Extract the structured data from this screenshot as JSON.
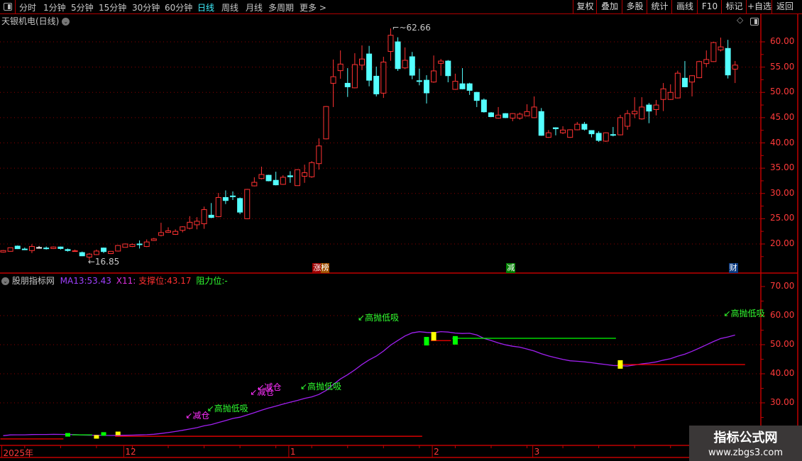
{
  "toolbar": {
    "periods": [
      "分时",
      "1分钟",
      "5分钟",
      "15分钟",
      "30分钟",
      "60分钟",
      "日线",
      "周线",
      "月线",
      "多周期",
      "更多 >"
    ],
    "active_period": "日线",
    "buttons": [
      "复权",
      "叠加",
      "多股",
      "统计",
      "画线",
      "F10",
      "标记",
      "+自选",
      "返回"
    ]
  },
  "price_panel": {
    "title": "天银机电(日线)",
    "axis_ticks": [
      "60.00",
      "55.00",
      "50.00",
      "45.00",
      "40.00",
      "35.00",
      "30.00",
      "25.00",
      "20.00"
    ],
    "high_label": "62.66",
    "low_label": "16.85",
    "tags": [
      {
        "text": "涨榜",
        "bar": 44,
        "colors": [
          "#a00000",
          "#a05000"
        ]
      },
      {
        "text": "减",
        "bar": 71,
        "colors": [
          "#008000"
        ]
      },
      {
        "text": "财",
        "bar": 102,
        "colors": [
          "#0a3a80"
        ]
      }
    ]
  },
  "indicator_panel": {
    "name": "股朋指标网",
    "ma13_label": "MA13:",
    "ma13_value": "53.43",
    "x11_label": "X11:",
    "support_label": "支撑位:",
    "support_value": "43.17",
    "resistance_label": "阻力位:",
    "resistance_value": "-",
    "axis_ticks": [
      "70.00",
      "60.00",
      "50.00",
      "40.00",
      "30.00"
    ],
    "signal_labels": [
      {
        "text": "减仓",
        "bar": 26,
        "value": 25.9,
        "color": "#ff30ff"
      },
      {
        "text": "高抛低吸",
        "bar": 29,
        "value": 28.3,
        "color": "#30ff30"
      },
      {
        "text": "减仓",
        "bar": 35,
        "value": 33.9,
        "color": "#ff30ff"
      },
      {
        "text": "减仓",
        "bar": 36,
        "value": 35.6,
        "color": "#ff30ff"
      },
      {
        "text": "高抛低吸",
        "bar": 42,
        "value": 35.9,
        "color": "#30ff30"
      },
      {
        "text": "高抛低吸",
        "bar": 50,
        "value": 59.5,
        "color": "#30ff30"
      },
      {
        "text": "高抛低吸",
        "bar": 101,
        "value": 61,
        "color": "#30ff30"
      }
    ],
    "signal_blocks": [
      {
        "bar": 9,
        "value": 19.0,
        "color": "#00ff00"
      },
      {
        "bar": 13,
        "value": 18.3,
        "color": "#ffff00"
      },
      {
        "bar": 14,
        "value": 19.3,
        "color": "#00ff00"
      },
      {
        "bar": 16,
        "value": 19.5,
        "color": "#ffff00"
      },
      {
        "bar": 59,
        "value": 51.2,
        "color": "#00ff00"
      },
      {
        "bar": 60,
        "value": 52.9,
        "color": "#ffff00"
      },
      {
        "bar": 63,
        "value": 51.5,
        "color": "#00ff00"
      },
      {
        "bar": 86,
        "value": 43.2,
        "color": "#ffff00"
      }
    ],
    "levels": [
      {
        "from": 0,
        "to": 8,
        "value": 17.6,
        "color": "#ff0000"
      },
      {
        "from": 10,
        "to": 12,
        "value": 19.0,
        "color": "#00ff00"
      },
      {
        "from": 16,
        "to": 58,
        "value": 18.5,
        "color": "#ff0000"
      },
      {
        "from": 60,
        "to": 62,
        "value": 51.4,
        "color": "#ff0000"
      },
      {
        "from": 63,
        "to": 85,
        "value": 52.2,
        "color": "#00ff00"
      },
      {
        "from": 86,
        "to": 103,
        "value": 43.17,
        "color": "#ff0000"
      }
    ]
  },
  "date_axis": [
    {
      "text": "2025年",
      "bar": 0
    },
    {
      "text": "12",
      "bar": 17
    },
    {
      "text": "1",
      "bar": 40
    },
    {
      "text": "2",
      "bar": 60
    },
    {
      "text": "3",
      "bar": 74
    }
  ],
  "watermark": {
    "line1": "指标公式网",
    "line2": "www.zbgs3.com"
  },
  "colors": {
    "up": "#ff3232",
    "down": "#54ffff",
    "ma": "#a020f0",
    "axis": "#c00000",
    "grid": "#8b0000"
  },
  "candles": [
    [
      18.4,
      18.8,
      18.3,
      18.7
    ],
    [
      18.55,
      19.3,
      18.5,
      19.26
    ],
    [
      19.58,
      19.7,
      19.0,
      19.06
    ],
    [
      19.0,
      19.3,
      18.8,
      18.95
    ],
    [
      18.7,
      19.96,
      18.2,
      19.5
    ],
    [
      19.3,
      19.6,
      19.2,
      19.3
    ],
    [
      19.2,
      19.5,
      18.9,
      19.1
    ],
    [
      19.1,
      19.5,
      19.0,
      19.4
    ],
    [
      19.4,
      19.5,
      18.9,
      19.1
    ],
    [
      18.9,
      19.1,
      18.5,
      18.7
    ],
    [
      18.55,
      18.9,
      18.5,
      18.65
    ],
    [
      18.3,
      18.5,
      17.6,
      17.65
    ],
    [
      17.4,
      18.2,
      16.85,
      18.0
    ],
    [
      17.9,
      18.9,
      17.8,
      18.6
    ],
    [
      19.2,
      19.3,
      18.2,
      18.5
    ],
    [
      18.1,
      18.6,
      18.0,
      18.55
    ],
    [
      18.6,
      19.8,
      18.5,
      19.7
    ],
    [
      19.34,
      20.1,
      19.3,
      20.0
    ],
    [
      19.5,
      20.1,
      19.4,
      19.9
    ],
    [
      20.0,
      20.7,
      19.1,
      19.95
    ],
    [
      19.5,
      20.9,
      19.4,
      20.4
    ],
    [
      20.7,
      21.2,
      20.6,
      21.0
    ],
    [
      21.7,
      24.2,
      21.5,
      22.25
    ],
    [
      22.3,
      23.3,
      22.2,
      22.6
    ],
    [
      21.9,
      22.9,
      21.8,
      22.5
    ],
    [
      22.7,
      23.5,
      22.3,
      23.4
    ],
    [
      23.1,
      25.5,
      22.9,
      24.3
    ],
    [
      23.8,
      25.3,
      22.9,
      24.5
    ],
    [
      24.0,
      27.4,
      23.0,
      26.8
    ],
    [
      25.7,
      28.1,
      25.1,
      25.25
    ],
    [
      25.4,
      30.1,
      25.3,
      29.2
    ],
    [
      29.2,
      30.6,
      27.9,
      28.6
    ],
    [
      29.5,
      30.4,
      28.7,
      29.4
    ],
    [
      29.0,
      29.2,
      25.9,
      26.3
    ],
    [
      25.0,
      30.9,
      24.9,
      30.8
    ],
    [
      31.5,
      33.2,
      31.4,
      32.2
    ],
    [
      32.95,
      35.3,
      32.8,
      33.75
    ],
    [
      33.6,
      33.7,
      32.4,
      32.5
    ],
    [
      32.6,
      34.3,
      31.6,
      31.7
    ],
    [
      31.8,
      33.6,
      31.7,
      33.2
    ],
    [
      33.5,
      34.4,
      32.1,
      33.3
    ],
    [
      31.55,
      34.8,
      31.5,
      34.7
    ],
    [
      33.4,
      35.7,
      32.1,
      34.1
    ],
    [
      33.3,
      36.4,
      33.1,
      36.1
    ],
    [
      35.9,
      40.9,
      34.7,
      39.4
    ],
    [
      40.8,
      47.3,
      40.7,
      47.2
    ],
    [
      51.8,
      56.5,
      47.1,
      53.1
    ],
    [
      54.3,
      58.3,
      52.7,
      55.6
    ],
    [
      51.8,
      54.8,
      49.1,
      51.1
    ],
    [
      50.9,
      57.75,
      50.8,
      55.5
    ],
    [
      55.4,
      59.3,
      54.4,
      56.6
    ],
    [
      57.6,
      59.2,
      51.2,
      52.4
    ],
    [
      53.2,
      55.1,
      49.2,
      49.7
    ],
    [
      49.85,
      57.05,
      48.9,
      56.0
    ],
    [
      58.1,
      62.66,
      56.25,
      61.3
    ],
    [
      60.0,
      60.9,
      54.25,
      54.7
    ],
    [
      54.85,
      58.9,
      54.6,
      56.35
    ],
    [
      57.05,
      58.0,
      52.6,
      53.4
    ],
    [
      52.3,
      54.7,
      51.4,
      52.2
    ],
    [
      52.4,
      53.4,
      47.8,
      49.9
    ],
    [
      52.05,
      57.3,
      51.9,
      54.25
    ],
    [
      55.75,
      56.6,
      53.3,
      56.2
    ],
    [
      56.2,
      56.4,
      52.0,
      53.3
    ],
    [
      50.6,
      53.7,
      50.5,
      52.2
    ],
    [
      51.7,
      54.8,
      50.6,
      50.7
    ],
    [
      51.7,
      51.9,
      49.5,
      50.4
    ],
    [
      50.0,
      50.1,
      47.1,
      48.4
    ],
    [
      48.5,
      48.8,
      46.0,
      46.15
    ],
    [
      45.95,
      46.1,
      45.1,
      45.2
    ],
    [
      44.9,
      47.1,
      44.8,
      45.5
    ],
    [
      45.8,
      45.9,
      44.9,
      45.0
    ],
    [
      44.9,
      45.9,
      44.3,
      45.8
    ],
    [
      44.9,
      46.0,
      44.6,
      45.7
    ],
    [
      45.35,
      47.65,
      45.3,
      46.2
    ],
    [
      45.0,
      49.2,
      44.9,
      47.1
    ],
    [
      46.2,
      46.9,
      41.4,
      41.5
    ],
    [
      41.1,
      42.55,
      41.0,
      42.0
    ],
    [
      43.0,
      43.1,
      41.5,
      42.8
    ],
    [
      42.0,
      43.3,
      41.75,
      42.55
    ],
    [
      41.1,
      42.7,
      41.0,
      42.6
    ],
    [
      42.6,
      44.15,
      42.5,
      43.7
    ],
    [
      43.7,
      44.15,
      42.45,
      42.7
    ],
    [
      42.45,
      42.5,
      41.1,
      41.8
    ],
    [
      41.9,
      42.3,
      40.2,
      40.5
    ],
    [
      40.35,
      42.1,
      40.2,
      42.0
    ],
    [
      41.65,
      43.15,
      41.3,
      41.6
    ],
    [
      41.6,
      45.55,
      41.5,
      45.0
    ],
    [
      43.3,
      46.5,
      42.6,
      45.8
    ],
    [
      45.75,
      49.05,
      44.9,
      46.25
    ],
    [
      44.75,
      49.05,
      44.6,
      47.1
    ],
    [
      47.5,
      47.9,
      43.9,
      46.3
    ],
    [
      46.6,
      48.5,
      45.45,
      47.5
    ],
    [
      48.6,
      51.85,
      46.3,
      50.7
    ],
    [
      48.6,
      51.6,
      48.5,
      50.0
    ],
    [
      48.9,
      54.3,
      48.8,
      53.8
    ],
    [
      52.8,
      56.2,
      51.0,
      51.1
    ],
    [
      52.05,
      53.4,
      49.2,
      53.3
    ],
    [
      52.9,
      56.25,
      52.8,
      56.1
    ],
    [
      55.7,
      58.3,
      55.0,
      56.5
    ],
    [
      56.1,
      60.0,
      56.0,
      59.86
    ],
    [
      58.4,
      60.84,
      58.1,
      59.0
    ],
    [
      58.7,
      60.4,
      52.75,
      53.45
    ],
    [
      54.6,
      56.2,
      51.85,
      55.4
    ]
  ]
}
